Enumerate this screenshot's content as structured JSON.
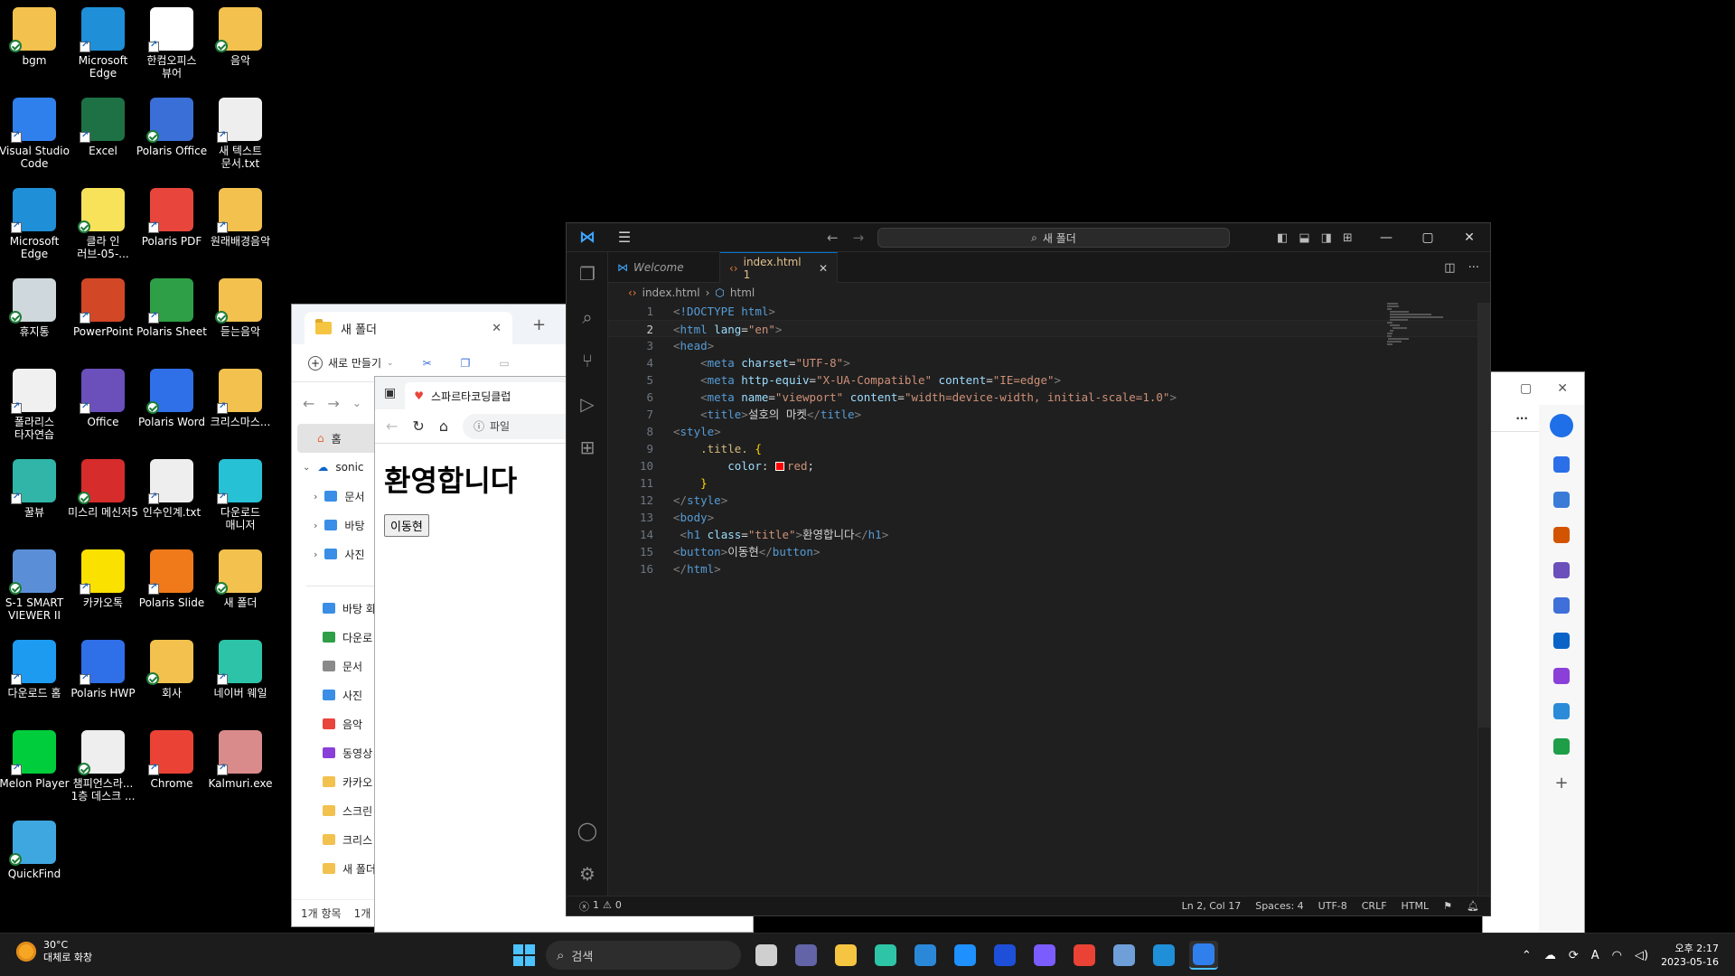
{
  "desktop_icons": [
    {
      "label": "bgm",
      "color": "#f2c14e"
    },
    {
      "label": "Microsoft Edge",
      "color": "#1f8fd8"
    },
    {
      "label": "한컴오피스 뷰어",
      "color": "#ffffff"
    },
    {
      "label": "음악",
      "color": "#f2c14e"
    },
    {
      "label": "Visual Studio Code",
      "color": "#2f80ed"
    },
    {
      "label": "Excel",
      "color": "#1e7145"
    },
    {
      "label": "Polaris Office",
      "color": "#3a6fd8"
    },
    {
      "label": "새 텍스트 문서.txt",
      "color": "#eeeeee"
    },
    {
      "label": "Microsoft Edge",
      "color": "#1f8fd8"
    },
    {
      "label": "클라 인 러브-05-...",
      "color": "#f7e25a"
    },
    {
      "label": "Polaris PDF",
      "color": "#e8453c"
    },
    {
      "label": "원래배경음악",
      "color": "#f2c14e"
    },
    {
      "label": "휴지통",
      "color": "#cfd8dc"
    },
    {
      "label": "PowerPoint",
      "color": "#d24726"
    },
    {
      "label": "Polaris Sheet",
      "color": "#2e9e47"
    },
    {
      "label": "듣는음악",
      "color": "#f2c14e"
    },
    {
      "label": "폴라리스 타자연습",
      "color": "#f0f0f0"
    },
    {
      "label": "Office",
      "color": "#6b4fbb"
    },
    {
      "label": "Polaris Word",
      "color": "#2f6fe8"
    },
    {
      "label": "크리스마스...",
      "color": "#f2c14e"
    },
    {
      "label": "꿀뷰",
      "color": "#30b5a8"
    },
    {
      "label": "미스리 메신저5",
      "color": "#d72c2c"
    },
    {
      "label": "인수인계.txt",
      "color": "#eeeeee"
    },
    {
      "label": "다운로드 매니저",
      "color": "#27c1d6"
    },
    {
      "label": "S-1 SMART VIEWER II",
      "color": "#5a8fd8"
    },
    {
      "label": "카카오톡",
      "color": "#fae100"
    },
    {
      "label": "Polaris Slide",
      "color": "#f07a1a"
    },
    {
      "label": "새 폴더",
      "color": "#f2c14e"
    },
    {
      "label": "다운로드 홈",
      "color": "#1d9bf0"
    },
    {
      "label": "Polaris HWP",
      "color": "#2f6fe8"
    },
    {
      "label": "회사",
      "color": "#f2c14e"
    },
    {
      "label": "네이버 웨일",
      "color": "#2cc3a8"
    },
    {
      "label": "Melon Player",
      "color": "#00cd3c"
    },
    {
      "label": "챔피언스라... 1층 데스크 ...",
      "color": "#eeeeee"
    },
    {
      "label": "Chrome",
      "color": "#ea4335"
    },
    {
      "label": "Kalmuri.exe",
      "color": "#d98b8b"
    },
    {
      "label": "QuickFind",
      "color": "#3fa7e0"
    }
  ],
  "explorer": {
    "tab_title": "새 폴더",
    "new_button": "새로 만들기",
    "sidebar_home": "홈",
    "sidebar_cloud": "sonic",
    "tree_items": [
      "문서",
      "바탕",
      "사진"
    ],
    "quick_items": [
      "바탕 화",
      "다운로",
      "문서",
      "사진",
      "음악",
      "동영상",
      "카카오",
      "스크린",
      "크리스",
      "새 폴더"
    ],
    "status": "1개 항목",
    "status2": "1개"
  },
  "browser": {
    "tab_title": "스파르타코딩클럽",
    "url_partial": "파일",
    "heading": "환영합니다",
    "button_label": "이동현"
  },
  "vscode": {
    "command_center": "새 폴더",
    "tabs": [
      {
        "label": "Welcome",
        "italic": true
      },
      {
        "label": "index.html 1",
        "active": true
      }
    ],
    "breadcrumb": [
      "index.html",
      "html"
    ],
    "current_line": 2,
    "status_errors": "1",
    "status_warnings": "0",
    "status_position": "Ln 2, Col 17",
    "status_spaces": "Spaces: 4",
    "status_encoding": "UTF-8",
    "status_eol": "CRLF",
    "status_language": "HTML",
    "code_lines": [
      "<!DOCTYPE html>",
      "<html lang=\"en\">",
      "<head>",
      "    <meta charset=\"UTF-8\">",
      "    <meta http-equiv=\"X-UA-Compatible\" content=\"IE=edge\">",
      "    <meta name=\"viewport\" content=\"width=device-width, initial-scale=1.0\">",
      "    <title>설호의 마켓</title>",
      "<style>",
      "    .title. {",
      "        color: red;",
      "    }",
      "</style>",
      "<body>",
      " <h1 class=\"title\">환영합니다</h1>",
      "<button>이동현</button>",
      "</html>"
    ]
  },
  "taskbar": {
    "weather_temp": "30°C",
    "weather_desc": "대체로 화창",
    "search_placeholder": "검색",
    "time": "오후 2:17",
    "date": "2023-05-16",
    "apps": [
      {
        "name": "task-view",
        "color": "#cfcfcf"
      },
      {
        "name": "teams",
        "color": "#6264a7"
      },
      {
        "name": "file-explorer",
        "color": "#f5c542"
      },
      {
        "name": "app-green",
        "color": "#2ec4a6"
      },
      {
        "name": "store",
        "color": "#2b88d8"
      },
      {
        "name": "mail",
        "color": "#1e90ff"
      },
      {
        "name": "app-blue",
        "color": "#1e4fd8"
      },
      {
        "name": "copilot",
        "color": "#7b5cff"
      },
      {
        "name": "chrome",
        "color": "#ea4335"
      },
      {
        "name": "app-viewer",
        "color": "#6f9fd8"
      },
      {
        "name": "edge",
        "color": "#1f8fd8"
      },
      {
        "name": "vscode",
        "color": "#2f80ed"
      }
    ]
  }
}
